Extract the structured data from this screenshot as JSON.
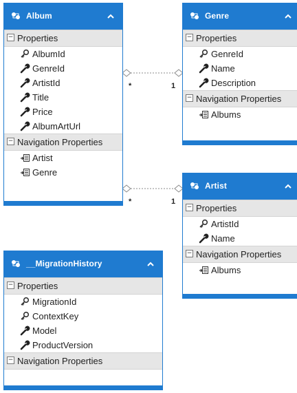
{
  "entities": {
    "album": {
      "title": "Album",
      "properties_label": "Properties",
      "properties": [
        {
          "name": "AlbumId",
          "icon": "key-icon"
        },
        {
          "name": "GenreId",
          "icon": "wrench-icon"
        },
        {
          "name": "ArtistId",
          "icon": "wrench-icon"
        },
        {
          "name": "Title",
          "icon": "wrench-icon"
        },
        {
          "name": "Price",
          "icon": "wrench-icon"
        },
        {
          "name": "AlbumArtUrl",
          "icon": "wrench-icon"
        }
      ],
      "nav_label": "Navigation Properties",
      "nav": [
        {
          "name": "Artist",
          "icon": "navigation-property-icon"
        },
        {
          "name": "Genre",
          "icon": "navigation-property-icon"
        }
      ]
    },
    "genre": {
      "title": "Genre",
      "properties_label": "Properties",
      "properties": [
        {
          "name": "GenreId",
          "icon": "key-icon"
        },
        {
          "name": "Name",
          "icon": "wrench-icon"
        },
        {
          "name": "Description",
          "icon": "wrench-icon"
        }
      ],
      "nav_label": "Navigation Properties",
      "nav": [
        {
          "name": "Albums",
          "icon": "navigation-property-icon"
        }
      ]
    },
    "artist": {
      "title": "Artist",
      "properties_label": "Properties",
      "properties": [
        {
          "name": "ArtistId",
          "icon": "key-icon"
        },
        {
          "name": "Name",
          "icon": "wrench-icon"
        }
      ],
      "nav_label": "Navigation Properties",
      "nav": [
        {
          "name": "Albums",
          "icon": "navigation-property-icon"
        }
      ]
    },
    "migration": {
      "title": "__MigrationHistory",
      "properties_label": "Properties",
      "properties": [
        {
          "name": "MigrationId",
          "icon": "key-icon"
        },
        {
          "name": "ContextKey",
          "icon": "key-icon"
        },
        {
          "name": "Model",
          "icon": "wrench-icon"
        },
        {
          "name": "ProductVersion",
          "icon": "wrench-icon"
        }
      ],
      "nav_label": "Navigation Properties",
      "nav": []
    }
  },
  "associations": [
    {
      "from": "Album",
      "to": "Genre",
      "from_multiplicity": "*",
      "to_multiplicity": "1"
    },
    {
      "from": "Album",
      "to": "Artist",
      "from_multiplicity": "*",
      "to_multiplicity": "1"
    }
  ],
  "colors": {
    "header": "#1f7bd0",
    "section": "#e6e6e6",
    "connector": "#8a8a8a"
  },
  "toggle_glyph": "−"
}
